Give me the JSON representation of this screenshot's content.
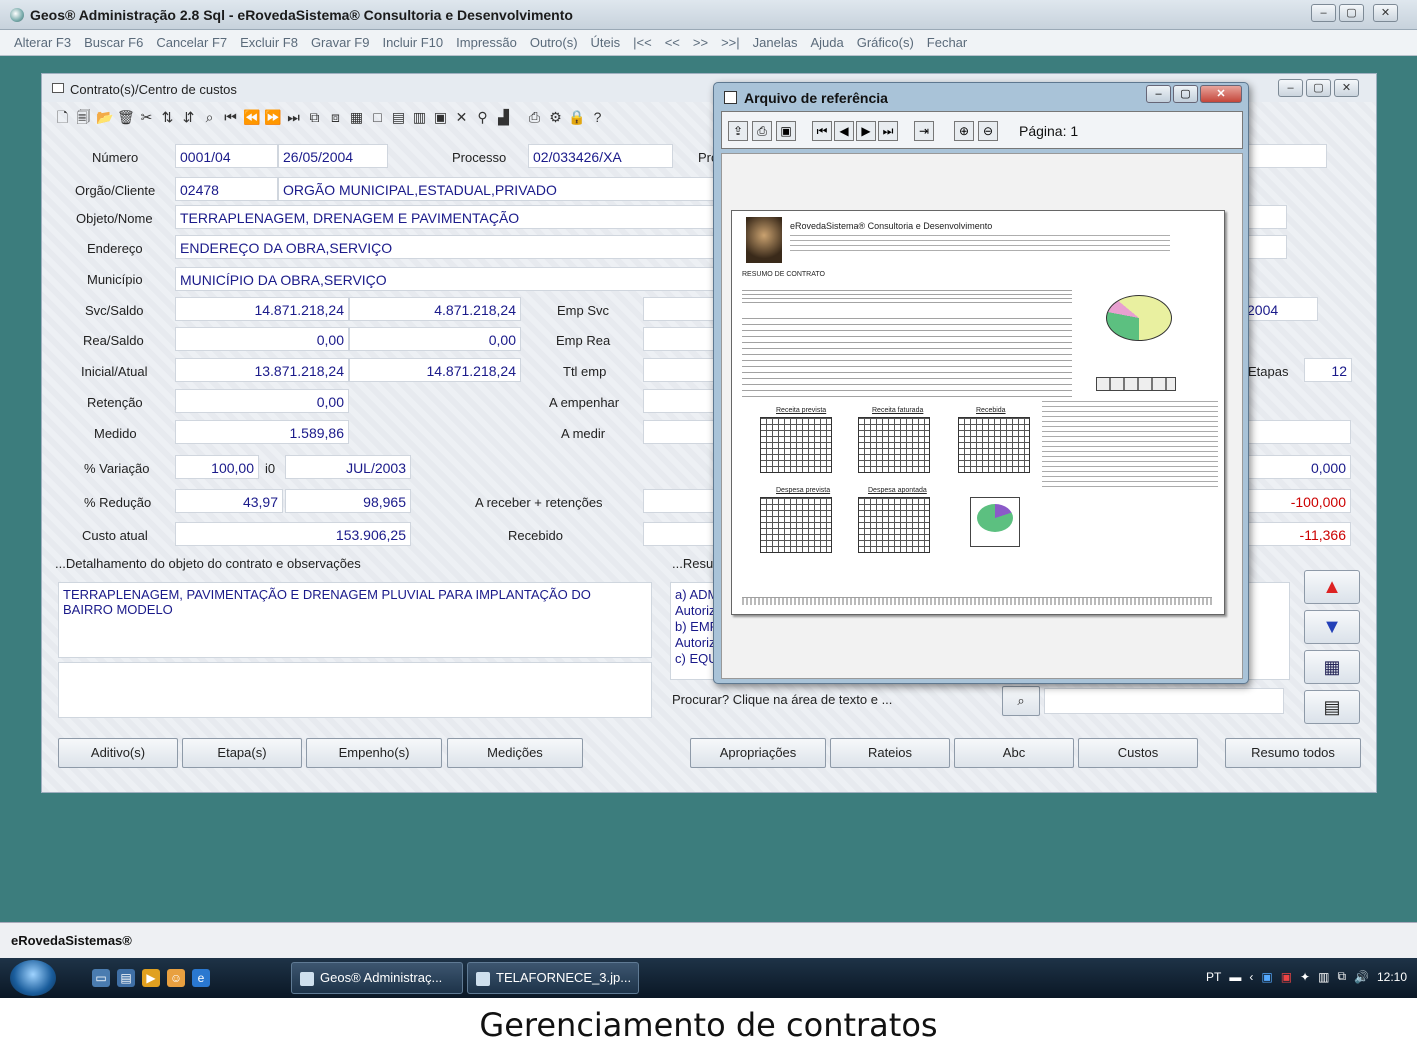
{
  "window": {
    "title": "Geos® Administração 2.8 Sql - eRovedaSistema® Consultoria e Desenvolvimento",
    "menu": [
      "Alterar F3",
      "Buscar F6",
      "Cancelar F7",
      "Excluir F8",
      "Gravar F9",
      "Incluir F10",
      "Impressão",
      "Outro(s)",
      "Úteis",
      "|<<",
      "<<",
      ">>",
      ">>|",
      "Janelas",
      "Ajuda",
      "Gráfico(s)",
      "Fechar"
    ]
  },
  "contratos": {
    "title": "Contrato(s)/Centro de custos",
    "labels": {
      "numero": "Número",
      "processo": "Processo",
      "pro": "Pro",
      "orgao": "Orgão/Cliente",
      "objeto": "Objeto/Nome",
      "endereco": "Endereço",
      "municipio": "Município",
      "svc_saldo": "Svc/Saldo",
      "emp_svc": "Emp Svc",
      "rea_saldo": "Rea/Saldo",
      "emp_rea": "Emp Rea",
      "inicial_atual": "Inicial/Atual",
      "ttl_emp": "Ttl emp",
      "retencao": "Retenção",
      "a_empenhar": "A empenhar",
      "medido": "Medido",
      "a_medir": "A medir",
      "variacao": "% Variação",
      "i0": "i0",
      "reducao": "% Redução",
      "a_receber": "A receber + retenções",
      "custo_atual": "Custo atual",
      "recebido": "Recebido",
      "etapas": "Etapas",
      "detalhamento": "...Detalhamento do objeto do contrato e observações",
      "resumo": "...Resu",
      "procurar": "Procurar? Clique na área de texto e ..."
    },
    "values": {
      "numero": "0001/04",
      "data": "26/05/2004",
      "processo": "02/033426/XA",
      "orgao_cod": "02478",
      "orgao_nome": "ORGÃO MUNICIPAL,ESTADUAL,PRIVADO",
      "objeto": "TERRAPLENAGEM, DRENAGEM E PAVIMENTAÇÃO",
      "endereco": "ENDEREÇO DA OBRA,SERVIÇO",
      "municipio": "MUNICÍPIO DA OBRA,SERVIÇO",
      "svc": "14.871.218,24",
      "saldo": "4.871.218,24",
      "rea": "0,00",
      "rea_saldo": "0,00",
      "inicial": "13.871.218,24",
      "atual": "14.871.218,24",
      "retencao": "0,00",
      "medido": "1.589,86",
      "variacao": "100,00",
      "i0": "JUL/2003",
      "reducao1": "43,97",
      "reducao2": "98,965",
      "custo_atual": "153.906,25",
      "right_year": "2004",
      "etapas": "12",
      "right_var": "0,000",
      "right_red": "-100,000",
      "right_custo": "-11,366"
    },
    "memo_text": "TERRAPLENAGEM, PAVIMENTAÇÃO E DRENAGEM PLUVIAL PARA IMPLANTAÇÃO DO BAIRRO MODELO",
    "resumo_lines": [
      "a) ADM",
      "Autoriz",
      "b) EMP",
      "Autoriz",
      "c) EQU"
    ],
    "buttons": [
      "Aditivo(s)",
      "Etapa(s)",
      "Empenho(s)",
      "Medições",
      "Apropriações",
      "Rateios",
      "Abc",
      "Custos",
      "Resumo todos"
    ]
  },
  "popup": {
    "title": "Arquivo de referência",
    "page_label": "Página: 1",
    "report_company": "eRovedaSistema® Consultoria e Desenvolvimento",
    "report_title": "RESUMO DE CONTRATO",
    "chart_labels": [
      "Receita prevista",
      "Receita faturada",
      "Recebida",
      "Despesa prevista",
      "Despesa apontada"
    ]
  },
  "status": {
    "text": "eRovedaSistemas®"
  },
  "taskbar": {
    "tasks": [
      "Geos® Administraç...",
      "TELAFORNECE_3.jp..."
    ],
    "lang": "PT",
    "time": "12:10"
  },
  "caption": "Gerenciamento de contratos"
}
